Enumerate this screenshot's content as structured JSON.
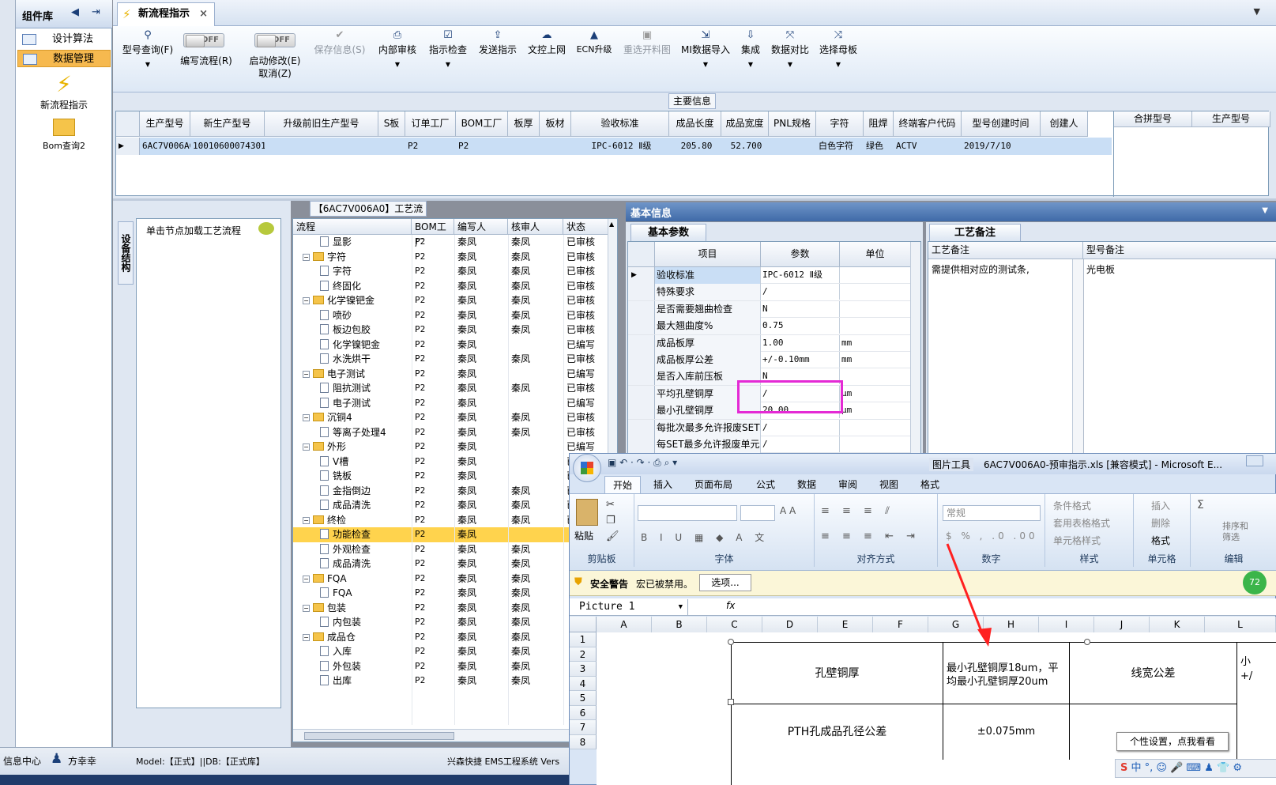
{
  "sidebar": {
    "title": "组件库",
    "items": [
      "设计算法",
      "数据管理"
    ],
    "big": [
      "新流程指示",
      "Bom查询2"
    ]
  },
  "tab": {
    "title": "新流程指示",
    "close": "×"
  },
  "toolbar": {
    "query": "型号查询(F)",
    "write": "编写流程(R)",
    "start": "启动修改(E)",
    "cancel": "取消(Z)",
    "off": "OFF",
    "save": "保存信息(S)",
    "internal": "内部审核",
    "check": "指示检查",
    "send": "发送指示",
    "upload": "文控上网",
    "ecn": "ECN升级",
    "rechoose": "重选开料图",
    "mi": "MI数据导入",
    "integrate": "集成",
    "compare": "数据对比",
    "mother": "选择母板"
  },
  "main_info": {
    "title": "主要信息",
    "headers": [
      "生产型号",
      "新生产型号",
      "升级前旧生产型号",
      "S板",
      "订单工厂",
      "BOM工厂",
      "板厚",
      "板材",
      "验收标准",
      "成品长度",
      "成品宽度",
      "PNL规格",
      "字符",
      "阻焊",
      "终端客户代码",
      "型号创建时间",
      "创建人"
    ],
    "row": [
      "6AC7V006A0",
      "10010600074301",
      "",
      "",
      "P2",
      "P2",
      "",
      "",
      "IPC-6012 Ⅱ级",
      "205.80",
      "52.700",
      "",
      "白色字符",
      "绿色",
      "ACTV",
      "2019/7/10",
      ""
    ],
    "side_headers": [
      "合拼型号",
      "生产型号"
    ]
  },
  "flow": {
    "title": "【6AC7V006A0】工艺流程",
    "side_tab": "设备结构",
    "hint": "单击节点加载工艺流程",
    "headers": [
      "流程",
      "BOM工厂",
      "编写人",
      "核审人",
      "状态"
    ],
    "rows": [
      {
        "lv": 2,
        "t": "doc",
        "n": "显影",
        "b": "P2",
        "w": "秦凤",
        "r": "秦凤",
        "s": "已审核"
      },
      {
        "lv": 1,
        "t": "fold",
        "n": "字符",
        "b": "P2",
        "w": "秦凤",
        "r": "秦凤",
        "s": "已审核"
      },
      {
        "lv": 2,
        "t": "doc",
        "n": "字符",
        "b": "P2",
        "w": "秦凤",
        "r": "秦凤",
        "s": "已审核"
      },
      {
        "lv": 2,
        "t": "doc",
        "n": "终固化",
        "b": "P2",
        "w": "秦凤",
        "r": "秦凤",
        "s": "已审核"
      },
      {
        "lv": 1,
        "t": "fold",
        "n": "化学镍钯金",
        "b": "P2",
        "w": "秦凤",
        "r": "秦凤",
        "s": "已审核"
      },
      {
        "lv": 2,
        "t": "doc",
        "n": "喷砂",
        "b": "P2",
        "w": "秦凤",
        "r": "秦凤",
        "s": "已审核"
      },
      {
        "lv": 2,
        "t": "doc",
        "n": "板边包胶",
        "b": "P2",
        "w": "秦凤",
        "r": "秦凤",
        "s": "已审核"
      },
      {
        "lv": 2,
        "t": "doc",
        "n": "化学镍钯金",
        "b": "P2",
        "w": "秦凤",
        "r": "",
        "s": "已编写"
      },
      {
        "lv": 2,
        "t": "doc",
        "n": "水洗烘干",
        "b": "P2",
        "w": "秦凤",
        "r": "秦凤",
        "s": "已审核"
      },
      {
        "lv": 1,
        "t": "fold",
        "n": "电子测试",
        "b": "P2",
        "w": "秦凤",
        "r": "",
        "s": "已编写"
      },
      {
        "lv": 2,
        "t": "doc",
        "n": "阻抗测试",
        "b": "P2",
        "w": "秦凤",
        "r": "秦凤",
        "s": "已审核"
      },
      {
        "lv": 2,
        "t": "doc",
        "n": "电子测试",
        "b": "P2",
        "w": "秦凤",
        "r": "",
        "s": "已编写"
      },
      {
        "lv": 1,
        "t": "fold",
        "n": "沉铜4",
        "b": "P2",
        "w": "秦凤",
        "r": "秦凤",
        "s": "已审核"
      },
      {
        "lv": 2,
        "t": "doc",
        "n": "等离子处理4",
        "b": "P2",
        "w": "秦凤",
        "r": "秦凤",
        "s": "已审核"
      },
      {
        "lv": 1,
        "t": "fold",
        "n": "外形",
        "b": "P2",
        "w": "秦凤",
        "r": "",
        "s": "已编写"
      },
      {
        "lv": 2,
        "t": "doc",
        "n": "V槽",
        "b": "P2",
        "w": "秦凤",
        "r": "",
        "s": "已编写"
      },
      {
        "lv": 2,
        "t": "doc",
        "n": "铣板",
        "b": "P2",
        "w": "秦凤",
        "r": "",
        "s": "已编写"
      },
      {
        "lv": 2,
        "t": "doc",
        "n": "金指倒边",
        "b": "P2",
        "w": "秦凤",
        "r": "秦凤",
        "s": "已审核"
      },
      {
        "lv": 2,
        "t": "doc",
        "n": "成品清洗",
        "b": "P2",
        "w": "秦凤",
        "r": "秦凤",
        "s": "已审核"
      },
      {
        "lv": 1,
        "t": "fold",
        "n": "终检",
        "b": "P2",
        "w": "秦凤",
        "r": "秦凤",
        "s": "已审核"
      },
      {
        "lv": 2,
        "t": "doc",
        "n": "功能检查",
        "b": "P2",
        "w": "秦凤",
        "r": "",
        "s": "",
        "sel": true
      },
      {
        "lv": 2,
        "t": "doc",
        "n": "外观检查",
        "b": "P2",
        "w": "秦凤",
        "r": "秦凤",
        "s": ""
      },
      {
        "lv": 2,
        "t": "doc",
        "n": "成品清洗",
        "b": "P2",
        "w": "秦凤",
        "r": "秦凤",
        "s": ""
      },
      {
        "lv": 1,
        "t": "fold",
        "n": "FQA",
        "b": "P2",
        "w": "秦凤",
        "r": "秦凤",
        "s": ""
      },
      {
        "lv": 2,
        "t": "doc",
        "n": "FQA",
        "b": "P2",
        "w": "秦凤",
        "r": "秦凤",
        "s": ""
      },
      {
        "lv": 1,
        "t": "fold",
        "n": "包装",
        "b": "P2",
        "w": "秦凤",
        "r": "秦凤",
        "s": ""
      },
      {
        "lv": 2,
        "t": "doc",
        "n": "内包装",
        "b": "P2",
        "w": "秦凤",
        "r": "秦凤",
        "s": ""
      },
      {
        "lv": 1,
        "t": "fold",
        "n": "成品仓",
        "b": "P2",
        "w": "秦凤",
        "r": "秦凤",
        "s": ""
      },
      {
        "lv": 2,
        "t": "doc",
        "n": "入库",
        "b": "P2",
        "w": "秦凤",
        "r": "秦凤",
        "s": ""
      },
      {
        "lv": 2,
        "t": "doc",
        "n": "外包装",
        "b": "P2",
        "w": "秦凤",
        "r": "秦凤",
        "s": ""
      },
      {
        "lv": 2,
        "t": "doc",
        "n": "出库",
        "b": "P2",
        "w": "秦凤",
        "r": "秦凤",
        "s": ""
      }
    ]
  },
  "basic": {
    "title": "基本信息",
    "tab": "基本参数",
    "headers": [
      "项目",
      "参数",
      "单位"
    ],
    "rows": [
      {
        "k": "验收标准",
        "v": "IPC-6012 Ⅱ级",
        "u": ""
      },
      {
        "k": "特殊要求",
        "v": "/",
        "u": ""
      },
      {
        "k": "是否需要翘曲检查",
        "v": "N",
        "u": ""
      },
      {
        "k": "最大翘曲度%",
        "v": "0.75",
        "u": ""
      },
      {
        "k": "成品板厚",
        "v": "1.00",
        "u": "mm"
      },
      {
        "k": "成品板厚公差",
        "v": "+/-0.10mm",
        "u": "mm"
      },
      {
        "k": "是否入库前压板",
        "v": "N",
        "u": ""
      },
      {
        "k": "平均孔壁铜厚",
        "v": "/",
        "u": "μm"
      },
      {
        "k": "最小孔壁铜厚",
        "v": "20.00",
        "u": "μm"
      },
      {
        "k": "每批次最多允许报废SET",
        "v": "/",
        "u": ""
      },
      {
        "k": "每SET最多允许报废单元",
        "v": "/",
        "u": ""
      }
    ]
  },
  "process_note": {
    "tab": "工艺备注",
    "headers": [
      "工艺备注",
      "型号备注"
    ],
    "note": "需提供相对应的测试条,",
    "model_note": "光电板"
  },
  "excel": {
    "title": "6AC7V006A0-预审指示.xls [兼容模式] - Microsoft E...",
    "tools": "图片工具",
    "tabs": [
      "开始",
      "插入",
      "页面布局",
      "公式",
      "数据",
      "审阅",
      "视图",
      "格式"
    ],
    "groups": [
      "剪贴板",
      "字体",
      "对齐方式",
      "数字",
      "样式",
      "单元格",
      "编辑"
    ],
    "paste": "粘贴",
    "number_format": "常规",
    "styles": [
      "条件格式",
      "套用表格格式",
      "单元格样式"
    ],
    "cells": [
      "插入",
      "删除",
      "格式"
    ],
    "sort": "排序和筛选",
    "security": "安全警告",
    "macro": "宏已被禁用。",
    "options": "选项...",
    "namebox": "Picture 1",
    "fx": "fx",
    "cols": [
      "A",
      "B",
      "C",
      "D",
      "E",
      "F",
      "G",
      "H",
      "I",
      "J",
      "K",
      "L"
    ],
    "rows": [
      "1",
      "2",
      "3",
      "4",
      "5",
      "6",
      "7",
      "8"
    ],
    "table": {
      "r1c1": "孔壁铜厚",
      "r1c2": "最小孔壁铜厚18um，平均最小孔壁铜厚20um",
      "r1c3": "线宽公差",
      "r2c1": "PTH孔成品孔径公差",
      "r2c2": "±0.075mm",
      "r1c4a": "小",
      "r1c4b": "+/"
    },
    "tooltip": "个性设置，点我看看",
    "badge": "72"
  },
  "status": {
    "info": "信息中心",
    "user": "方幸幸",
    "model": "Model:【正式】||DB:【正式库】",
    "company": "兴森快捷 EMS工程系统 Vers"
  }
}
